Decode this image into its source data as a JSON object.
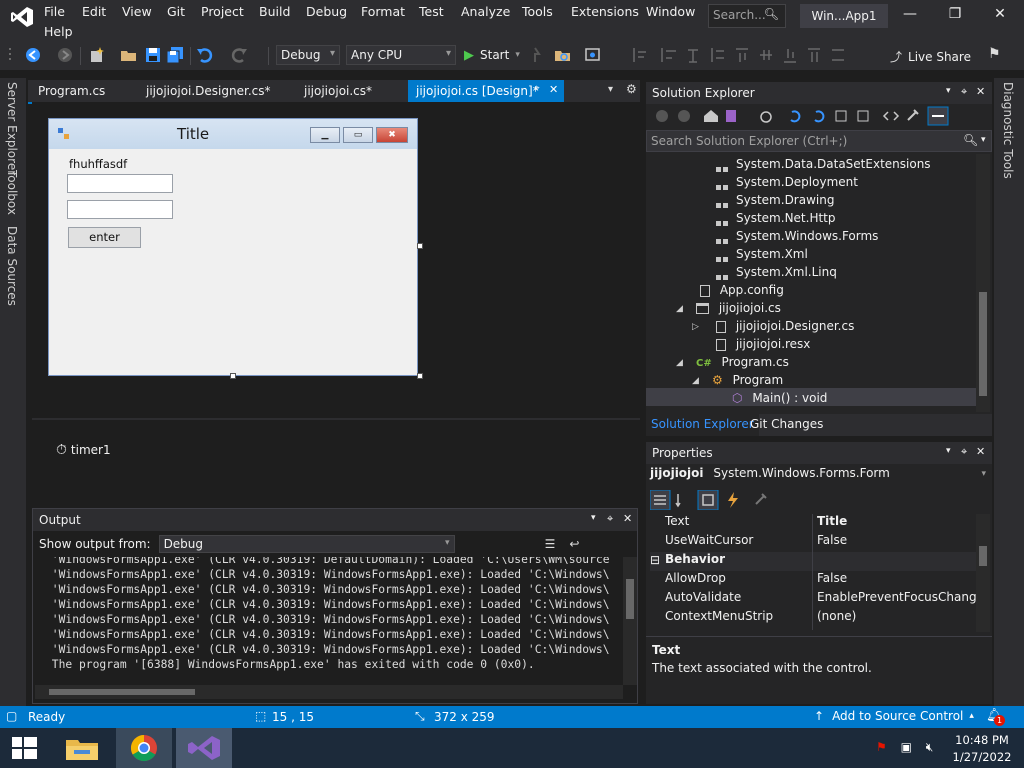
{
  "menu": {
    "items": [
      "File",
      "Edit",
      "View",
      "Git",
      "Project",
      "Build",
      "Debug",
      "Format",
      "Test",
      "Analyze",
      "Tools",
      "Extensions",
      "Window",
      "Help"
    ],
    "search_placeholder": "Search...",
    "solution_title": "Win...App1"
  },
  "toolbar": {
    "config": "Debug",
    "platform": "Any CPU",
    "start_label": "Start",
    "live_share": "Live Share"
  },
  "left_strip": {
    "items": [
      "Server Explorer",
      "Toolbox",
      "Data Sources"
    ]
  },
  "right_strip": {
    "items": [
      "Diagnostic Tools"
    ]
  },
  "tabs": [
    {
      "label": "Program.cs"
    },
    {
      "label": "jijojiojoi.Designer.cs*"
    },
    {
      "label": "jijojiojoi.cs*"
    },
    {
      "label": "jijojiojoi.cs [Design]*"
    }
  ],
  "form": {
    "title": "Title",
    "label_text": "fhuhffasdf",
    "button_text": "enter"
  },
  "tray": {
    "component": "timer1"
  },
  "output": {
    "title": "Output",
    "show_from_label": "Show output from:",
    "source": "Debug",
    "lines": [
      " 'WindowsFormsApp1.exe' (CLR v4.0.30319: DefaultDomain): Loaded 'C:\\Users\\WM\\source",
      " 'WindowsFormsApp1.exe' (CLR v4.0.30319: WindowsFormsApp1.exe): Loaded 'C:\\Windows\\",
      " 'WindowsFormsApp1.exe' (CLR v4.0.30319: WindowsFormsApp1.exe): Loaded 'C:\\Windows\\",
      " 'WindowsFormsApp1.exe' (CLR v4.0.30319: WindowsFormsApp1.exe): Loaded 'C:\\Windows\\",
      " 'WindowsFormsApp1.exe' (CLR v4.0.30319: WindowsFormsApp1.exe): Loaded 'C:\\Windows\\",
      " 'WindowsFormsApp1.exe' (CLR v4.0.30319: WindowsFormsApp1.exe): Loaded 'C:\\Windows\\",
      " 'WindowsFormsApp1.exe' (CLR v4.0.30319: WindowsFormsApp1.exe): Loaded 'C:\\Windows\\",
      " The program '[6388] WindowsFormsApp1.exe' has exited with code 0 (0x0)."
    ]
  },
  "solution_explorer": {
    "title": "Solution Explorer",
    "search_placeholder": "Search Solution Explorer (Ctrl+;)",
    "references": [
      "System.Data.DataSetExtensions",
      "System.Deployment",
      "System.Drawing",
      "System.Net.Http",
      "System.Windows.Forms",
      "System.Xml",
      "System.Xml.Linq"
    ],
    "app_config": "App.config",
    "form_file": "jijojiojoi.cs",
    "designer_file": "jijojiojoi.Designer.cs",
    "resx_file": "jijojiojoi.resx",
    "program_file": "Program.cs",
    "program_class": "Program",
    "main_method": "Main() : void",
    "bottom_tabs": [
      "Solution Explorer",
      "Git Changes"
    ]
  },
  "properties": {
    "title": "Properties",
    "object_name": "jijojiojoi",
    "object_type": "System.Windows.Forms.Form",
    "rows": [
      {
        "name": "Text",
        "value": "Title"
      },
      {
        "name": "UseWaitCursor",
        "value": "False"
      }
    ],
    "category": "Behavior",
    "behavior_rows": [
      {
        "name": "AllowDrop",
        "value": "False"
      },
      {
        "name": "AutoValidate",
        "value": "EnablePreventFocusChange"
      },
      {
        "name": "ContextMenuStrip",
        "value": "(none)"
      }
    ],
    "desc_title": "Text",
    "desc_text": "The text associated with the control."
  },
  "status": {
    "state": "Ready",
    "position": "15 , 15",
    "size": "372 x 259",
    "source_control": "Add to Source Control",
    "notifications": "1"
  },
  "taskbar": {
    "time": "10:48 PM",
    "date": "1/27/2022"
  },
  "colors": {
    "accent": "#007acc",
    "vs_purple": "#68217a",
    "chrome": "#2d2d30"
  }
}
